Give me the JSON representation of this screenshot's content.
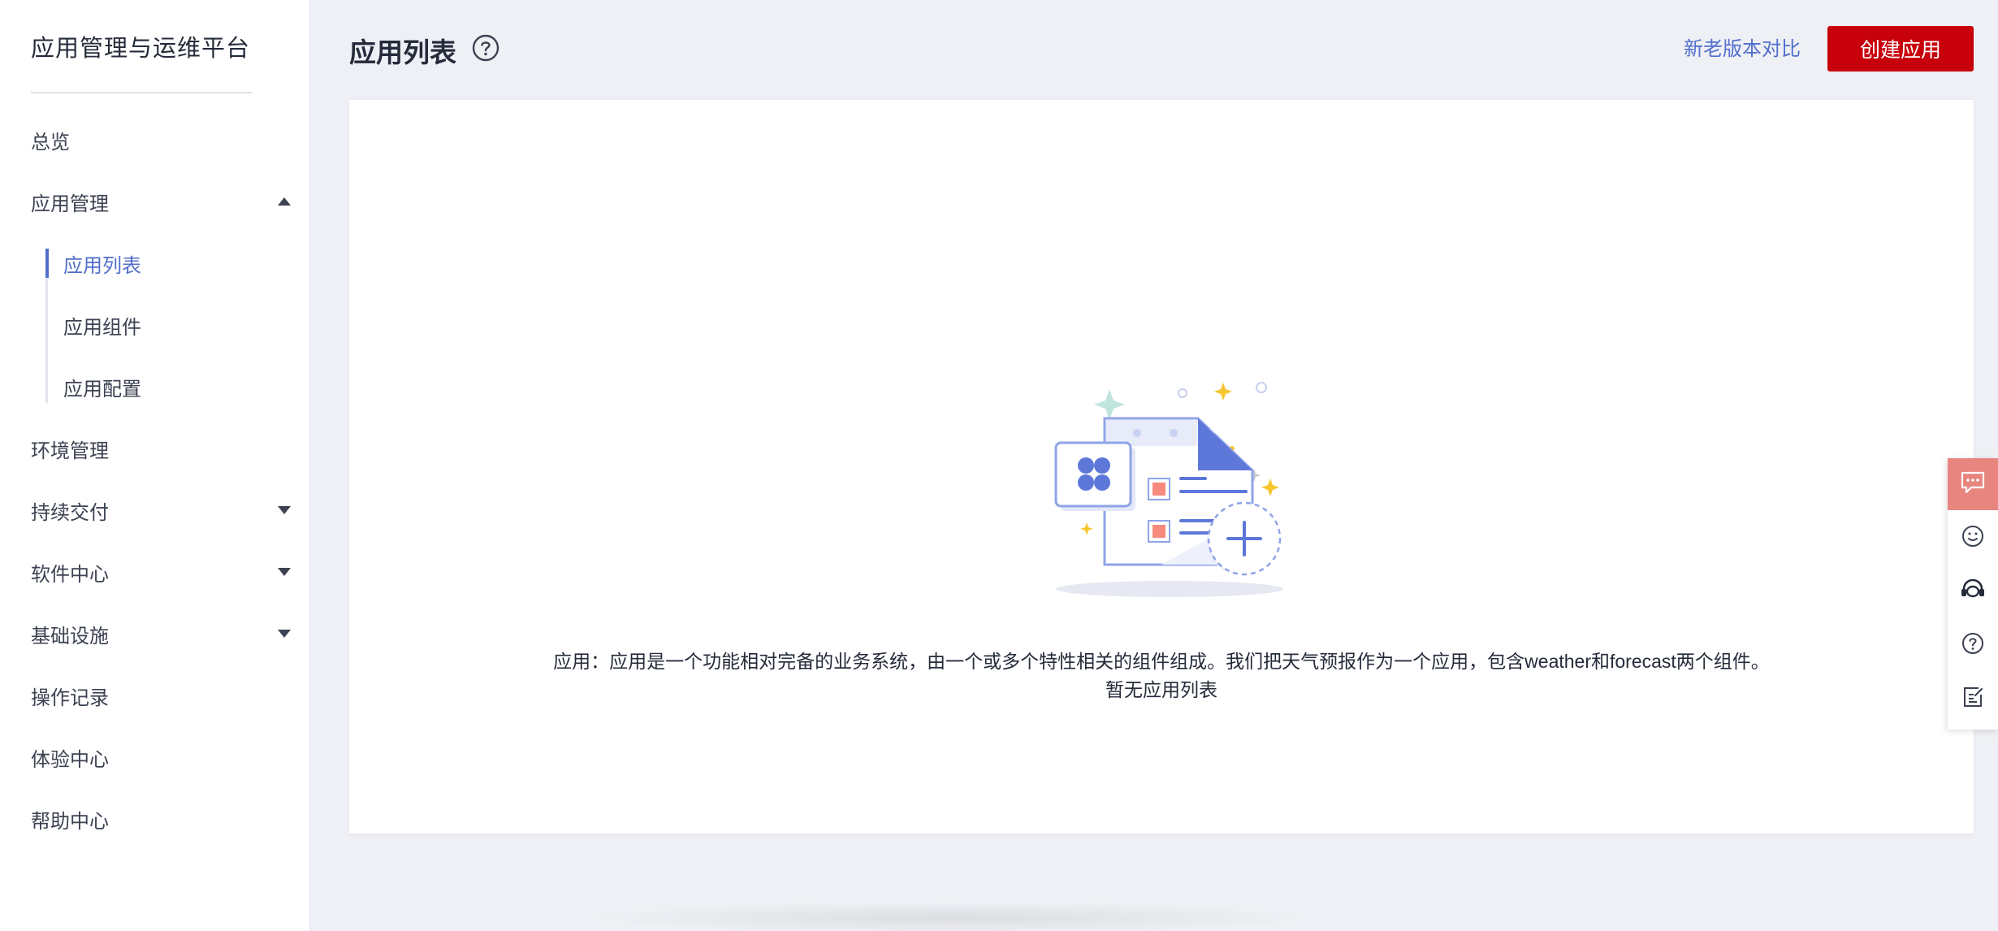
{
  "sidebar": {
    "title": "应用管理与运维平台",
    "items": [
      {
        "label": "总览"
      },
      {
        "label": "应用管理"
      },
      {
        "label": "环境管理"
      },
      {
        "label": "持续交付"
      },
      {
        "label": "软件中心"
      },
      {
        "label": "基础设施"
      },
      {
        "label": "操作记录"
      },
      {
        "label": "体验中心"
      },
      {
        "label": "帮助中心"
      }
    ],
    "sub_items": [
      {
        "label": "应用列表"
      },
      {
        "label": "应用组件"
      },
      {
        "label": "应用配置"
      }
    ]
  },
  "header": {
    "title": "应用列表",
    "compare_link": "新老版本对比",
    "create_button": "创建应用"
  },
  "empty_state": {
    "description": "应用：应用是一个功能相对完备的业务系统，由一个或多个特性相关的组件组成。我们把天气预报作为一个应用，包含weather和forecast两个组件。",
    "title": "暂无应用列表"
  },
  "colors": {
    "accent": "#526ecc",
    "primary_button": "#c7000b",
    "float_primary": "#e8857f"
  },
  "float_toolbar": {
    "icons": [
      "chat-icon",
      "smile-icon",
      "headset-icon",
      "question-icon",
      "edit-note-icon"
    ]
  }
}
